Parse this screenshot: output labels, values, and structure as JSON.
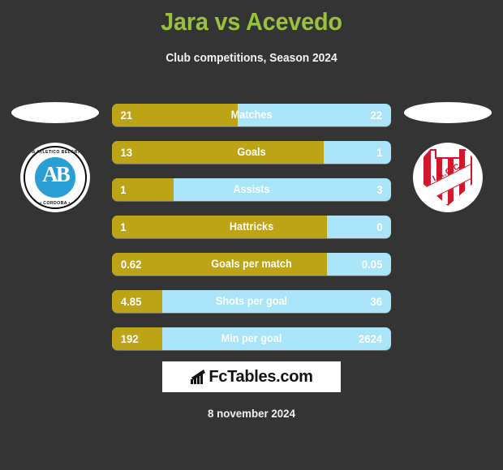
{
  "header": {
    "title": "Jara vs Acevedo",
    "subtitle": "Club competitions, Season 2024"
  },
  "teams": {
    "home": {
      "crest_name": "club-atletico-belgrano-cordoba",
      "crest_line_top": "CLUB ATLETICO BELGRANO",
      "crest_line_bottom": "• CORDOBA •",
      "crest_monogram": "AB"
    },
    "away": {
      "crest_name": "instituto-atletico-central-cordoba",
      "crest_abbr": "I.A.C.C."
    }
  },
  "colors": {
    "background": "#343434",
    "title": "#9ac13c",
    "home_bar": "#bda316",
    "away_bar": "#a9e4f9",
    "text": "#ffffff"
  },
  "footer": {
    "logo_text": "FcTables.com",
    "logo_icon": "bar-chart-icon",
    "date": "8 november 2024"
  },
  "chart_data": {
    "type": "bar",
    "title": "Jara vs Acevedo",
    "subtitle": "Club competitions, Season 2024",
    "xlabel": "",
    "ylabel": "",
    "orientation": "horizontal-diverging",
    "legend": [
      "Jara",
      "Acevedo"
    ],
    "categories": [
      "Matches",
      "Goals",
      "Assists",
      "Hattricks",
      "Goals per match",
      "Shots per goal",
      "Min per goal"
    ],
    "series": [
      {
        "name": "Jara",
        "values": [
          21,
          13,
          1,
          1,
          0.62,
          4.85,
          192
        ],
        "display": [
          "21",
          "13",
          "1",
          "1",
          "0.62",
          "4.85",
          "192"
        ],
        "fill_percent": [
          45,
          76,
          22,
          77,
          77,
          18,
          18
        ]
      },
      {
        "name": "Acevedo",
        "values": [
          22,
          1,
          3,
          0,
          0.05,
          36,
          2624
        ],
        "display": [
          "22",
          "1",
          "3",
          "0",
          "0.05",
          "36",
          "2624"
        ],
        "fill_percent": [
          55,
          24,
          78,
          23,
          23,
          82,
          82
        ]
      }
    ],
    "rows": [
      {
        "label": "Matches",
        "home": "21",
        "away": "22",
        "home_percent": 45
      },
      {
        "label": "Goals",
        "home": "13",
        "away": "1",
        "home_percent": 76
      },
      {
        "label": "Assists",
        "home": "1",
        "away": "3",
        "home_percent": 22
      },
      {
        "label": "Hattricks",
        "home": "1",
        "away": "0",
        "home_percent": 77
      },
      {
        "label": "Goals per match",
        "home": "0.62",
        "away": "0.05",
        "home_percent": 77
      },
      {
        "label": "Shots per goal",
        "home": "4.85",
        "away": "36",
        "home_percent": 18
      },
      {
        "label": "Min per goal",
        "home": "192",
        "away": "2624",
        "home_percent": 18
      }
    ]
  }
}
